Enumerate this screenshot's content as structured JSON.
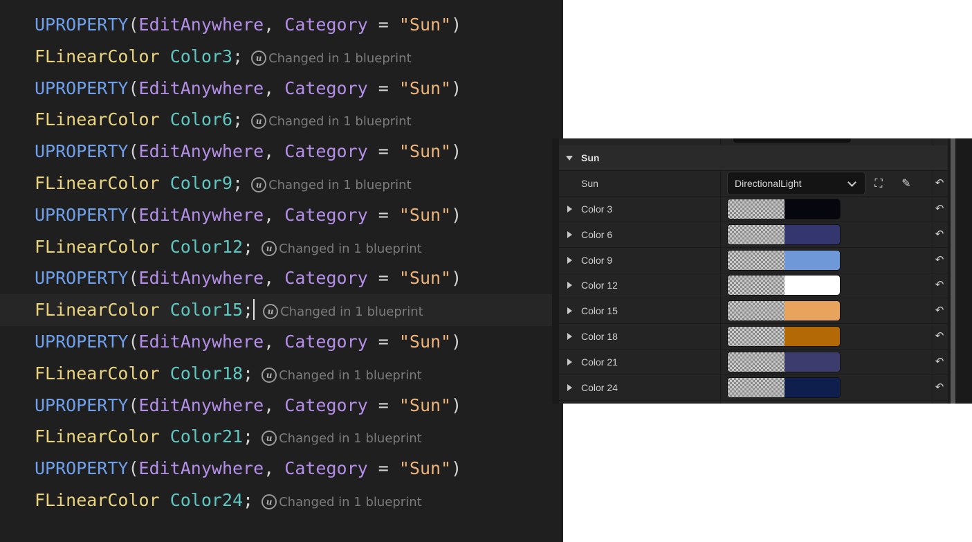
{
  "editor": {
    "caret_line": 9,
    "lines": [
      {
        "kind": "uprop",
        "macro": "UPROPERTY",
        "open": "(",
        "spec": "EditAnywhere",
        "comma": ", ",
        "cat_key": "Category",
        "eq": " = ",
        "value": "\"Sun\"",
        "close": ")"
      },
      {
        "kind": "decl",
        "type": "FLinearColor",
        "name": "Color3",
        "semi": ";",
        "hint": "Changed in 1 blueprint"
      },
      {
        "kind": "uprop",
        "macro": "UPROPERTY",
        "open": "(",
        "spec": "EditAnywhere",
        "comma": ", ",
        "cat_key": "Category",
        "eq": " = ",
        "value": "\"Sun\"",
        "close": ")"
      },
      {
        "kind": "decl",
        "type": "FLinearColor",
        "name": "Color6",
        "semi": ";",
        "hint": "Changed in 1 blueprint"
      },
      {
        "kind": "uprop",
        "macro": "UPROPERTY",
        "open": "(",
        "spec": "EditAnywhere",
        "comma": ", ",
        "cat_key": "Category",
        "eq": " = ",
        "value": "\"Sun\"",
        "close": ")"
      },
      {
        "kind": "decl",
        "type": "FLinearColor",
        "name": "Color9",
        "semi": ";",
        "hint": "Changed in 1 blueprint"
      },
      {
        "kind": "uprop",
        "macro": "UPROPERTY",
        "open": "(",
        "spec": "EditAnywhere",
        "comma": ", ",
        "cat_key": "Category",
        "eq": " = ",
        "value": "\"Sun\"",
        "close": ")"
      },
      {
        "kind": "decl",
        "type": "FLinearColor",
        "name": "Color12",
        "semi": ";",
        "hint": "Changed in 1 blueprint"
      },
      {
        "kind": "uprop",
        "macro": "UPROPERTY",
        "open": "(",
        "spec": "EditAnywhere",
        "comma": ", ",
        "cat_key": "Category",
        "eq": " = ",
        "value": "\"Sun\"",
        "close": ")"
      },
      {
        "kind": "decl",
        "type": "FLinearColor",
        "name": "Color15",
        "semi": ";",
        "hint": "Changed in 1 blueprint"
      },
      {
        "kind": "uprop",
        "macro": "UPROPERTY",
        "open": "(",
        "spec": "EditAnywhere",
        "comma": ", ",
        "cat_key": "Category",
        "eq": " = ",
        "value": "\"Sun\"",
        "close": ")"
      },
      {
        "kind": "decl",
        "type": "FLinearColor",
        "name": "Color18",
        "semi": ";",
        "hint": "Changed in 1 blueprint"
      },
      {
        "kind": "uprop",
        "macro": "UPROPERTY",
        "open": "(",
        "spec": "EditAnywhere",
        "comma": ", ",
        "cat_key": "Category",
        "eq": " = ",
        "value": "\"Sun\"",
        "close": ")"
      },
      {
        "kind": "decl",
        "type": "FLinearColor",
        "name": "Color21",
        "semi": ";",
        "hint": "Changed in 1 blueprint"
      },
      {
        "kind": "uprop",
        "macro": "UPROPERTY",
        "open": "(",
        "spec": "EditAnywhere",
        "comma": ", ",
        "cat_key": "Category",
        "eq": " = ",
        "value": "\"Sun\"",
        "close": ")"
      },
      {
        "kind": "decl",
        "type": "FLinearColor",
        "name": "Color24",
        "semi": ";",
        "hint": "Changed in 1 blueprint"
      }
    ],
    "ue_icon_glyph": "u"
  },
  "details": {
    "category": "Sun",
    "sun_row": {
      "label": "Sun",
      "value": "DirectionalLight",
      "browse_glyph": "⛶",
      "pick_glyph": "✎"
    },
    "reset_glyph": "↶",
    "colors": [
      {
        "label": "Color 3",
        "hex": "#06060e"
      },
      {
        "label": "Color 6",
        "hex": "#343670"
      },
      {
        "label": "Color 9",
        "hex": "#6f98d8"
      },
      {
        "label": "Color 12",
        "hex": "#ffffff"
      },
      {
        "label": "Color 15",
        "hex": "#e8a35c"
      },
      {
        "label": "Color 18",
        "hex": "#b36a06"
      },
      {
        "label": "Color 21",
        "hex": "#3c3d6e"
      },
      {
        "label": "Color 24",
        "hex": "#0e1f4e"
      }
    ]
  }
}
